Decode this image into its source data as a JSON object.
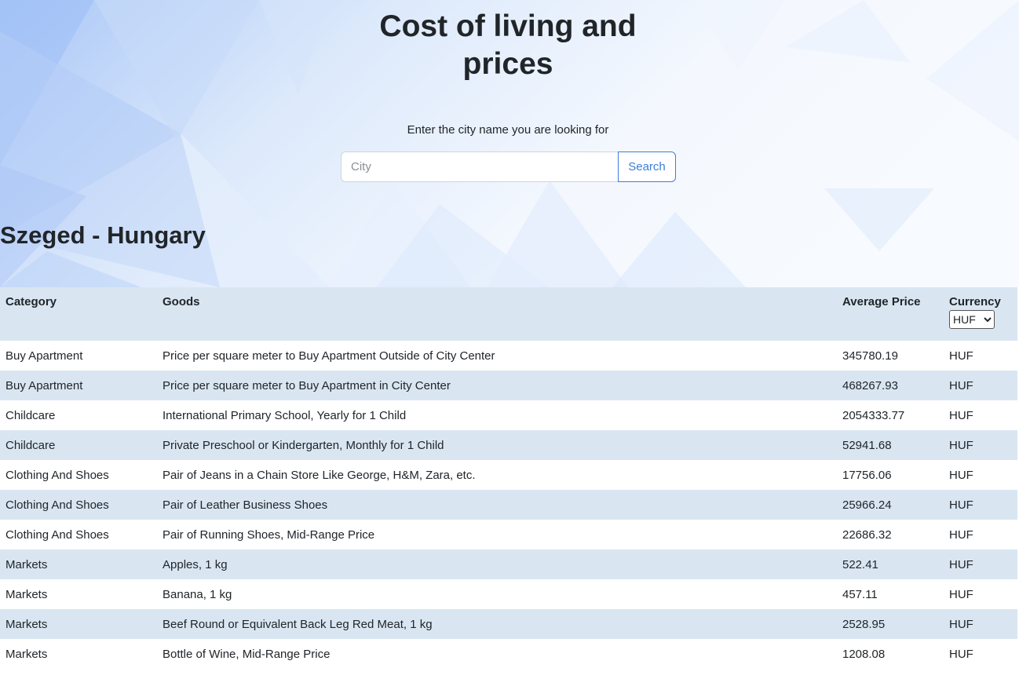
{
  "header": {
    "title_line1": "Cost of living and",
    "title_line2": "prices",
    "prompt": "Enter the city name you are looking for"
  },
  "search": {
    "placeholder": "City",
    "value": "",
    "button_label": "Search"
  },
  "city": {
    "heading": "Szeged - Hungary"
  },
  "table": {
    "headers": {
      "category": "Category",
      "goods": "Goods",
      "average_price": "Average Price",
      "currency": "Currency"
    },
    "currency_selected": "HUF",
    "rows": [
      {
        "category": "Buy Apartment",
        "goods": "Price per square meter to Buy Apartment Outside of City Center",
        "price": "345780.19",
        "currency": "HUF"
      },
      {
        "category": "Buy Apartment",
        "goods": "Price per square meter to Buy Apartment in City Center",
        "price": "468267.93",
        "currency": "HUF"
      },
      {
        "category": "Childcare",
        "goods": "International Primary School, Yearly for 1 Child",
        "price": "2054333.77",
        "currency": "HUF"
      },
      {
        "category": "Childcare",
        "goods": "Private Preschool or Kindergarten, Monthly for 1 Child",
        "price": "52941.68",
        "currency": "HUF"
      },
      {
        "category": "Clothing And Shoes",
        "goods": "Pair of Jeans in a Chain Store Like George, H&M, Zara, etc.",
        "price": "17756.06",
        "currency": "HUF"
      },
      {
        "category": "Clothing And Shoes",
        "goods": "Pair of Leather Business Shoes",
        "price": "25966.24",
        "currency": "HUF"
      },
      {
        "category": "Clothing And Shoes",
        "goods": "Pair of Running Shoes, Mid-Range Price",
        "price": "22686.32",
        "currency": "HUF"
      },
      {
        "category": "Markets",
        "goods": "Apples, 1 kg",
        "price": "522.41",
        "currency": "HUF"
      },
      {
        "category": "Markets",
        "goods": "Banana, 1 kg",
        "price": "457.11",
        "currency": "HUF"
      },
      {
        "category": "Markets",
        "goods": "Beef Round or Equivalent Back Leg Red Meat, 1 kg",
        "price": "2528.95",
        "currency": "HUF"
      },
      {
        "category": "Markets",
        "goods": "Bottle of Wine, Mid-Range Price",
        "price": "1208.08",
        "currency": "HUF"
      }
    ]
  },
  "colors": {
    "accent": "#3d7ddc",
    "row_stripe": "#d9e6f2",
    "text": "#212529"
  }
}
